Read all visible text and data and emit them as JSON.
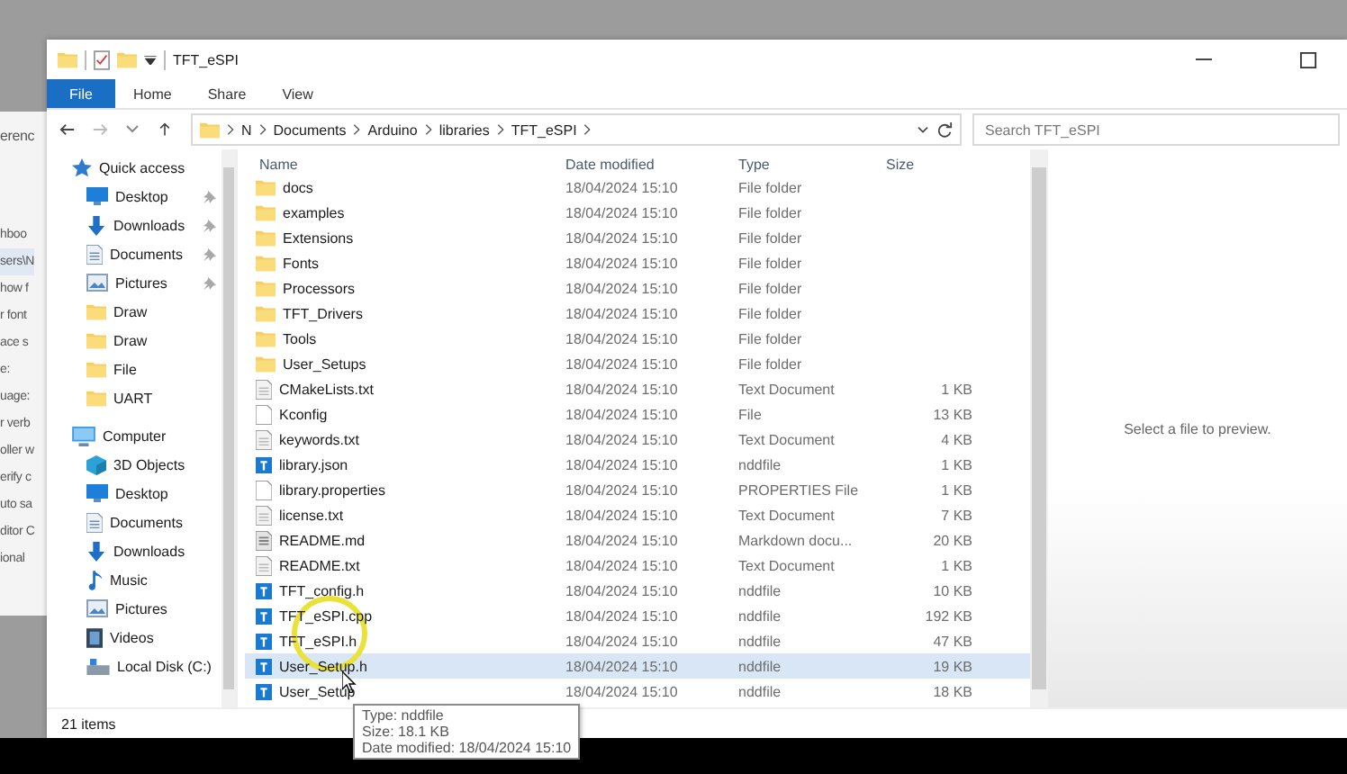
{
  "background_window": {
    "lines": [
      {
        "text": "erenc",
        "kind": "plain"
      },
      {
        "text": "hboo",
        "kind": "plain"
      },
      {
        "text": "sers\\N",
        "kind": "field"
      },
      {
        "text": "how f",
        "kind": "plain"
      },
      {
        "text": "r font",
        "kind": "plain"
      },
      {
        "text": "ace s",
        "kind": "plain"
      },
      {
        "text": "e:",
        "kind": "plain"
      },
      {
        "text": "uage:",
        "kind": "plain"
      },
      {
        "text": "r verb",
        "kind": "plain"
      },
      {
        "text": "oller w",
        "kind": "plain"
      },
      {
        "text": "erify c",
        "kind": "plain"
      },
      {
        "text": "uto sa",
        "kind": "plain"
      },
      {
        "text": "ditor C",
        "kind": "plain"
      },
      {
        "text": "ional",
        "kind": "plain"
      }
    ]
  },
  "window": {
    "title": "TFT_eSPI"
  },
  "ribbon": {
    "file_button": "File",
    "tabs": [
      "Home",
      "Share",
      "View"
    ]
  },
  "address_bar": {
    "path": [
      "N",
      "Documents",
      "Arduino",
      "libraries",
      "TFT_eSPI"
    ]
  },
  "search": {
    "placeholder": "Search TFT_eSPI"
  },
  "nav_pane": {
    "sections": [
      {
        "label": "Quick access",
        "kind": "star",
        "children": [
          {
            "label": "Desktop",
            "kind": "desktop",
            "pinned": true
          },
          {
            "label": "Downloads",
            "kind": "download",
            "pinned": true
          },
          {
            "label": "Documents",
            "kind": "document",
            "pinned": true
          },
          {
            "label": "Pictures",
            "kind": "pictures",
            "pinned": true
          },
          {
            "label": "Draw",
            "kind": "folder",
            "pinned": false
          },
          {
            "label": "Draw",
            "kind": "folder",
            "pinned": false
          },
          {
            "label": "File",
            "kind": "folder",
            "pinned": false
          },
          {
            "label": "UART",
            "kind": "folder",
            "pinned": false
          }
        ]
      },
      {
        "label": "Computer",
        "kind": "computer",
        "children": [
          {
            "label": "3D Objects",
            "kind": "cube",
            "pinned": false
          },
          {
            "label": "Desktop",
            "kind": "desktop",
            "pinned": false
          },
          {
            "label": "Documents",
            "kind": "document",
            "pinned": false
          },
          {
            "label": "Downloads",
            "kind": "download",
            "pinned": false
          },
          {
            "label": "Music",
            "kind": "music",
            "pinned": false
          },
          {
            "label": "Pictures",
            "kind": "pictures",
            "pinned": false
          },
          {
            "label": "Videos",
            "kind": "videos",
            "pinned": false
          },
          {
            "label": "Local Disk (C:)",
            "kind": "disk",
            "pinned": false
          }
        ]
      }
    ]
  },
  "file_list": {
    "columns": [
      "Name",
      "Date modified",
      "Type",
      "Size"
    ],
    "rows": [
      {
        "name": "docs",
        "date": "18/04/2024 15:10",
        "type": "File folder",
        "size": "",
        "kind": "folder",
        "selected": false
      },
      {
        "name": "examples",
        "date": "18/04/2024 15:10",
        "type": "File folder",
        "size": "",
        "kind": "folder",
        "selected": false
      },
      {
        "name": "Extensions",
        "date": "18/04/2024 15:10",
        "type": "File folder",
        "size": "",
        "kind": "folder",
        "selected": false
      },
      {
        "name": "Fonts",
        "date": "18/04/2024 15:10",
        "type": "File folder",
        "size": "",
        "kind": "folder",
        "selected": false
      },
      {
        "name": "Processors",
        "date": "18/04/2024 15:10",
        "type": "File folder",
        "size": "",
        "kind": "folder",
        "selected": false
      },
      {
        "name": "TFT_Drivers",
        "date": "18/04/2024 15:10",
        "type": "File folder",
        "size": "",
        "kind": "folder",
        "selected": false
      },
      {
        "name": "Tools",
        "date": "18/04/2024 15:10",
        "type": "File folder",
        "size": "",
        "kind": "folder",
        "selected": false
      },
      {
        "name": "User_Setups",
        "date": "18/04/2024 15:10",
        "type": "File folder",
        "size": "",
        "kind": "folder",
        "selected": false
      },
      {
        "name": "CMakeLists.txt",
        "date": "18/04/2024 15:10",
        "type": "Text Document",
        "size": "1 KB",
        "kind": "text",
        "selected": false
      },
      {
        "name": "Kconfig",
        "date": "18/04/2024 15:10",
        "type": "File",
        "size": "13 KB",
        "kind": "blank",
        "selected": false
      },
      {
        "name": "keywords.txt",
        "date": "18/04/2024 15:10",
        "type": "Text Document",
        "size": "4 KB",
        "kind": "text",
        "selected": false
      },
      {
        "name": "library.json",
        "date": "18/04/2024 15:10",
        "type": "nddfile",
        "size": "1 KB",
        "kind": "code",
        "selected": false
      },
      {
        "name": "library.properties",
        "date": "18/04/2024 15:10",
        "type": "PROPERTIES File",
        "size": "1 KB",
        "kind": "blank",
        "selected": false
      },
      {
        "name": "license.txt",
        "date": "18/04/2024 15:10",
        "type": "Text Document",
        "size": "7 KB",
        "kind": "text",
        "selected": false
      },
      {
        "name": "README.md",
        "date": "18/04/2024 15:10",
        "type": "Markdown docu...",
        "size": "20 KB",
        "kind": "markdown",
        "selected": false
      },
      {
        "name": "README.txt",
        "date": "18/04/2024 15:10",
        "type": "Text Document",
        "size": "1 KB",
        "kind": "text",
        "selected": false
      },
      {
        "name": "TFT_config.h",
        "date": "18/04/2024 15:10",
        "type": "nddfile",
        "size": "10 KB",
        "kind": "code",
        "selected": false
      },
      {
        "name": "TFT_eSPI.cpp",
        "date": "18/04/2024 15:10",
        "type": "nddfile",
        "size": "192 KB",
        "kind": "code",
        "selected": false
      },
      {
        "name": "TFT_eSPI.h",
        "date": "18/04/2024 15:10",
        "type": "nddfile",
        "size": "47 KB",
        "kind": "code",
        "selected": false
      },
      {
        "name": "User_Setup.h",
        "date": "18/04/2024 15:10",
        "type": "nddfile",
        "size": "19 KB",
        "kind": "code",
        "selected": true
      },
      {
        "name": "User_Setup",
        "date": "18/04/2024 15:10",
        "type": "nddfile",
        "size": "18 KB",
        "kind": "code",
        "selected": false
      }
    ]
  },
  "tooltip": {
    "lines": [
      "Type: nddfile",
      "Size: 18.1 KB",
      "Date modified: 18/04/2024 15:10"
    ]
  },
  "preview_pane": {
    "message": "Select a file to preview."
  },
  "status_bar": {
    "count": "21 items"
  }
}
